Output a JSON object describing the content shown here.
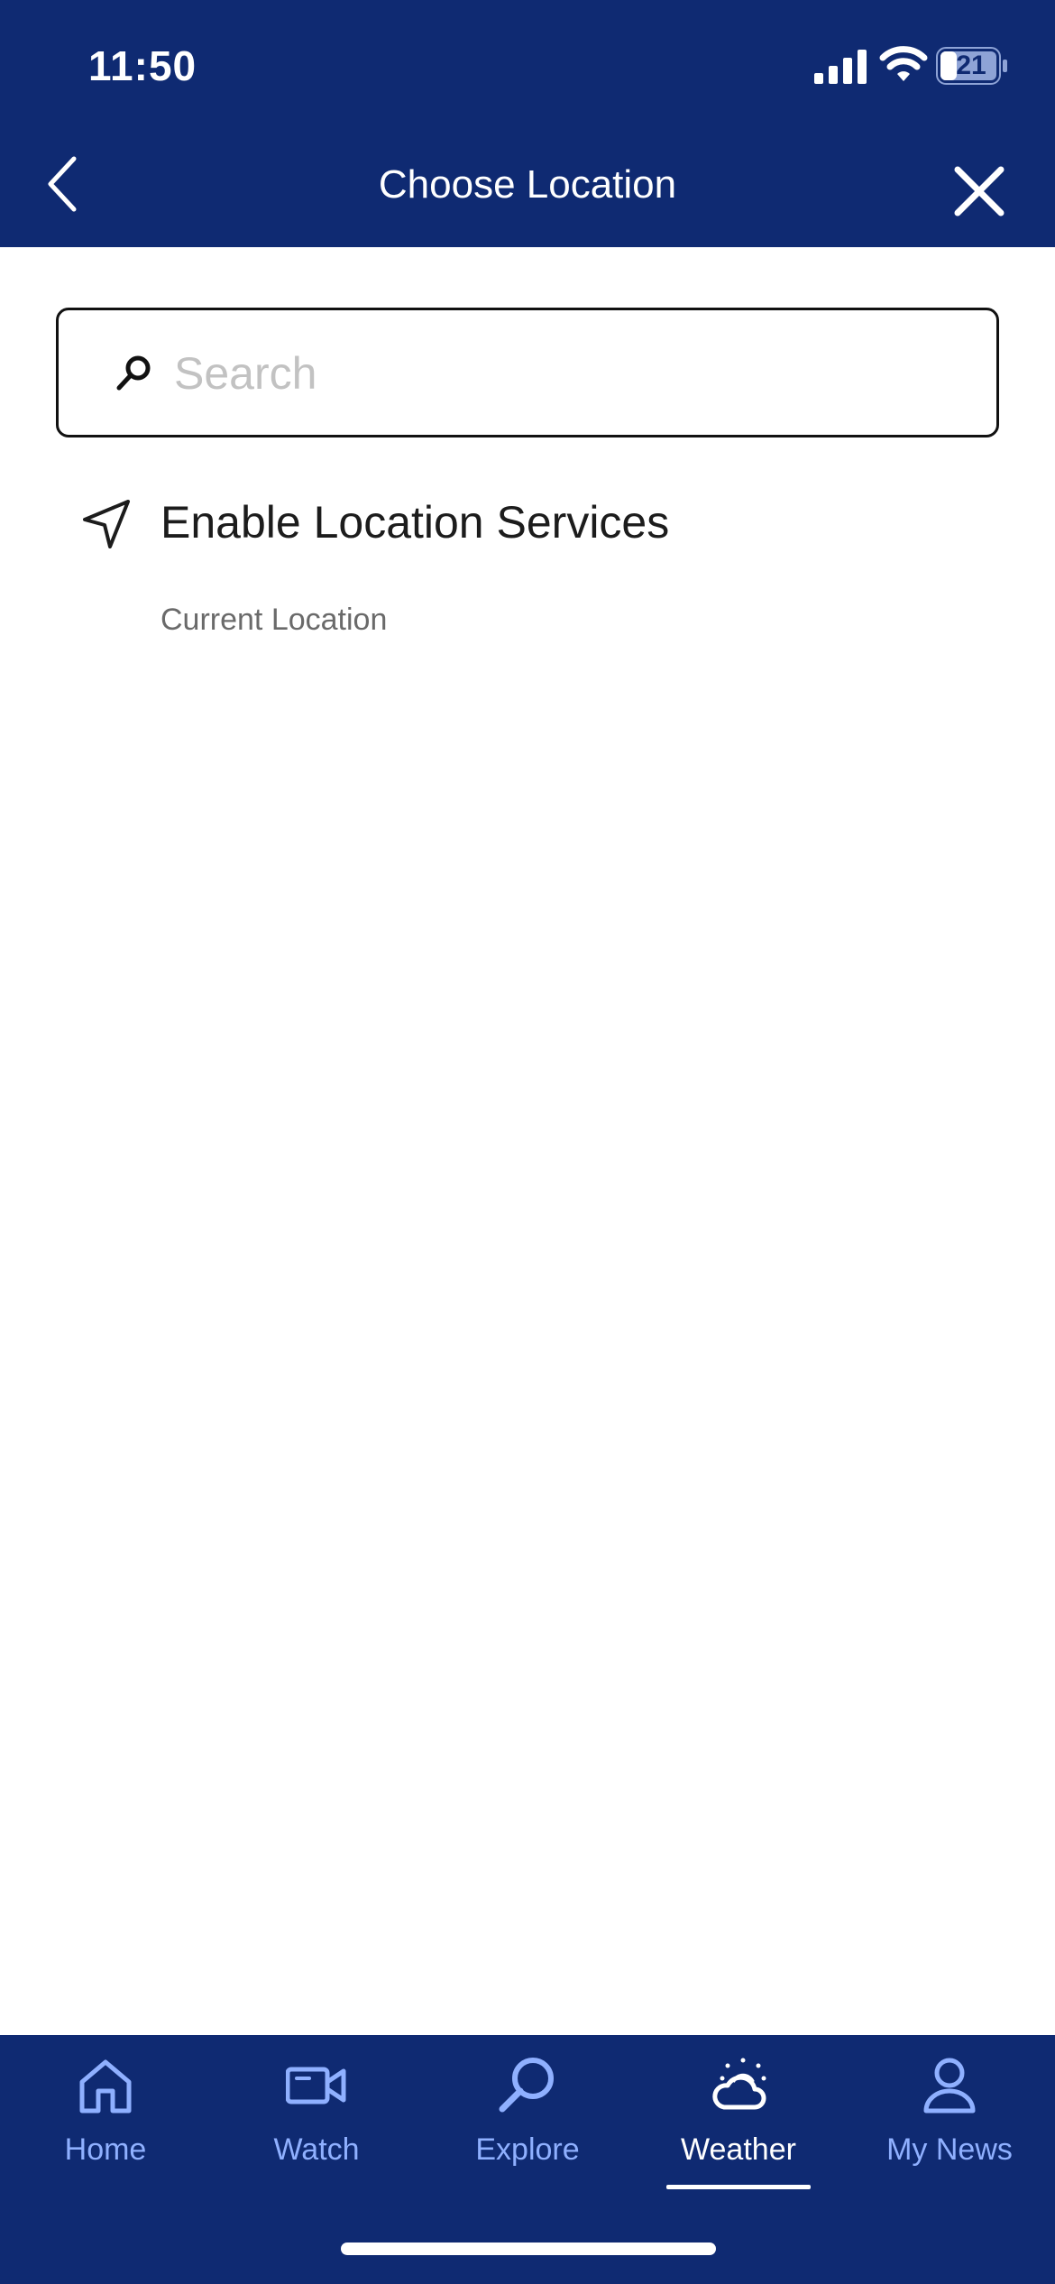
{
  "status_bar": {
    "time": "11:50",
    "battery": "21",
    "icons": [
      "signal-icon",
      "wifi-icon",
      "battery-icon"
    ]
  },
  "nav": {
    "title": "Choose Location",
    "back_icon": "chevron-left-icon",
    "close_icon": "close-icon"
  },
  "search": {
    "placeholder": "Search",
    "value": "",
    "icon": "search-icon"
  },
  "location": {
    "label": "Enable Location Services",
    "subtitle": "Current Location",
    "icon": "location-arrow-icon"
  },
  "tabs": [
    {
      "label": "Home",
      "icon": "home-icon"
    },
    {
      "label": "Watch",
      "icon": "video-camera-icon"
    },
    {
      "label": "Explore",
      "icon": "search-icon"
    },
    {
      "label": "Weather",
      "icon": "weather-icon",
      "active": true
    },
    {
      "label": "My News",
      "icon": "person-icon"
    }
  ],
  "colors": {
    "brand_navy": "#0f2a72",
    "tab_inactive": "#8fb0ff",
    "tab_active": "#ffffff",
    "placeholder": "#c2c2c2",
    "subtitle": "#6a6a6a"
  }
}
